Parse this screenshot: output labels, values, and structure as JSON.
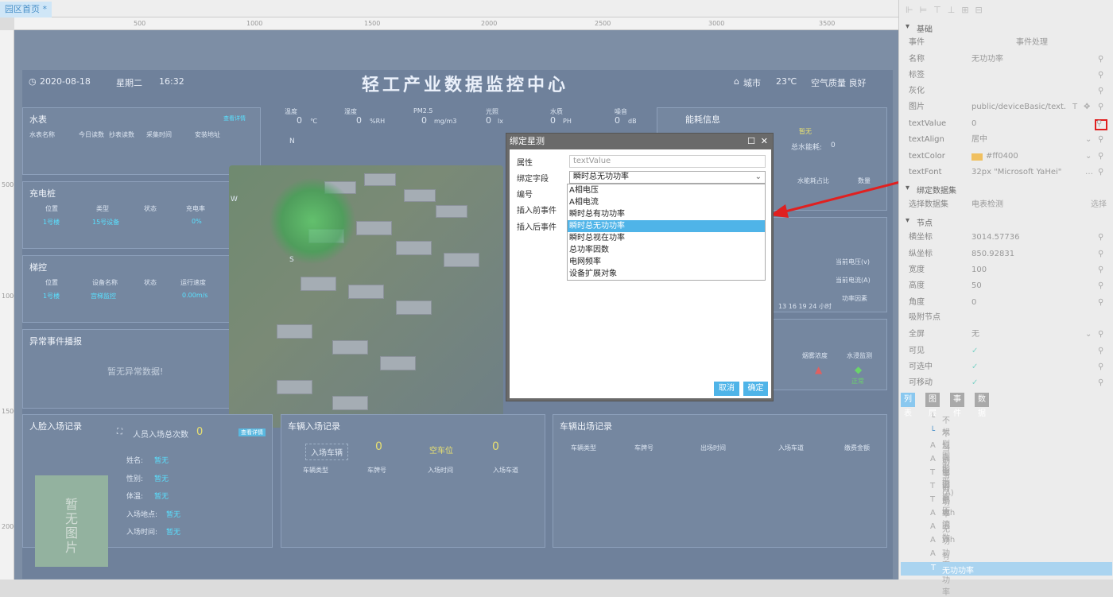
{
  "tab": {
    "title": "园区首页 *"
  },
  "ruler": {
    "h": [
      "500",
      "1000",
      "1500",
      "2000",
      "2500",
      "3000",
      "3500"
    ],
    "v": [
      "500",
      "1000",
      "1500",
      "2000"
    ]
  },
  "dashboard": {
    "date": "2020-08-18",
    "weekday": "星期二",
    "time": "16:32",
    "title": "轻工产业数据监控中心",
    "city": "城市",
    "temp": "23℃",
    "air": "空气质量 良好",
    "env": [
      {
        "label": "温度",
        "value": "0",
        "unit": "℃"
      },
      {
        "label": "湿度",
        "value": "0",
        "unit": "%RH"
      },
      {
        "label": "PM2.5",
        "value": "0",
        "unit": "mg/m3"
      },
      {
        "label": "光照",
        "value": "0",
        "unit": "lx"
      },
      {
        "label": "水质",
        "value": "0",
        "unit": "PH"
      },
      {
        "label": "噪音",
        "value": "0",
        "unit": "dB"
      }
    ],
    "water": {
      "title": "水表",
      "link": "查看详情",
      "cols": [
        "水表名称",
        "今日读数",
        "抄表读数",
        "采集时间",
        "安装地址"
      ]
    },
    "charger": {
      "title": "充电桩",
      "cols": [
        "位置",
        "类型",
        "状态",
        "充电率"
      ],
      "row": [
        "1号楼",
        "15号设备",
        "",
        "0%"
      ]
    },
    "elevator": {
      "title": "梯控",
      "cols": [
        "位置",
        "设备名称",
        "状态",
        "运行速度"
      ],
      "row": [
        "1号楼",
        "宫梯监控",
        "",
        "0.00m/s"
      ]
    },
    "alarm": {
      "title": "异常事件播报",
      "empty": "暂无异常数据!"
    },
    "energy": {
      "title": "能耗信息",
      "none": "暂无",
      "total_label": "总水能耗:",
      "total": "0",
      "col1": "水能耗占比",
      "col2": "数量"
    },
    "rightvals": {
      "v": "当前电压(v)",
      "a": "当前电流(A)",
      "f": "功率因素",
      "ticks": "13 16 19   24 小时"
    },
    "status": {
      "smoke": "烟雾浓度",
      "water": "水浸监测",
      "water_state": "正常"
    },
    "face": {
      "title": "人脸入场记录",
      "count_label": "人员入场总次数",
      "count": "0",
      "btn": "查看详情",
      "photo": "暂无图片",
      "fields": [
        [
          "姓名:",
          "暂无"
        ],
        [
          "性别:",
          "暂无"
        ],
        [
          "体温:",
          "暂无"
        ],
        [
          "入场地点:",
          "暂无"
        ],
        [
          "入场时间:",
          "暂无"
        ]
      ]
    },
    "carin": {
      "title": "车辆入场记录",
      "box1": "入场车辆",
      "v1": "0",
      "box2": "空车位",
      "v2": "0",
      "cols": [
        "车辆类型",
        "车牌号",
        "入场时间",
        "入场车道"
      ]
    },
    "carout": {
      "title": "车辆出场记录",
      "cols": [
        "车辆类型",
        "车牌号",
        "出场时间",
        "入场车道",
        "缴费金额"
      ]
    },
    "compass": {
      "n": "N",
      "w": "W",
      "s": "S"
    }
  },
  "dialog": {
    "title": "绑定星测",
    "attr_label": "属性",
    "attr_value": "textValue",
    "field_label": "绑定字段",
    "field_value": "瞬时总无功功率",
    "num_label": "编号",
    "before_label": "插入前事件",
    "after_label": "插入后事件",
    "options": [
      "A相电压",
      "A相电流",
      "瞬时总有功功率",
      "瞬时总无功功率",
      "瞬时总视在功率",
      "总功率因数",
      "电网频率",
      "设备扩展对象"
    ],
    "selected_index": 3,
    "cancel": "取消",
    "ok": "确定"
  },
  "props": {
    "section_basic": "基础",
    "rows": [
      [
        "事件",
        "事件处理"
      ],
      [
        "名称",
        "无功功率"
      ],
      [
        "标签",
        ""
      ],
      [
        "灰化",
        ""
      ],
      [
        "图片",
        "public/deviceBasic/text.js"
      ],
      [
        "textValue",
        "0"
      ],
      [
        "textAlign",
        "居中"
      ],
      [
        "textColor",
        "#ff0400"
      ],
      [
        "textFont",
        "32px \"Microsoft YaHei\""
      ]
    ],
    "section_bind": "绑定数据集",
    "ds_label": "选择数据集",
    "ds_value": "电表检测",
    "ds_btn": "选择",
    "section_node": "节点",
    "node_rows": [
      [
        "横坐标",
        "3014.57736"
      ],
      [
        "纵坐标",
        "850.92831"
      ],
      [
        "宽度",
        "100"
      ],
      [
        "高度",
        "50"
      ],
      [
        "角度",
        "0"
      ],
      [
        "吸附节点",
        ""
      ],
      [
        "全屏",
        "无"
      ],
      [
        "可见",
        "✓"
      ],
      [
        "可选中",
        "✓"
      ],
      [
        "可移动",
        "✓"
      ]
    ],
    "tabs": [
      "列表",
      "图层",
      "事件",
      "数据"
    ],
    "list": [
      "不规则图形",
      "不规则图形",
      "当前电流(A)",
      "功率因素",
      "当前电压",
      "当前电流",
      "功率因数",
      "Wh",
      "无功功率",
      "Wh",
      "有功功率",
      "无功功率"
    ]
  }
}
